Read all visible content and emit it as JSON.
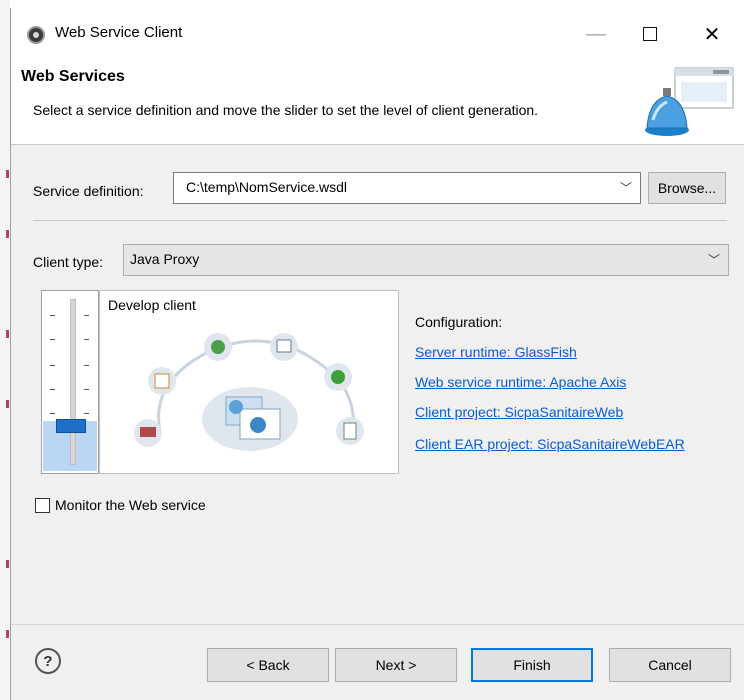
{
  "window": {
    "title": "Web Service Client",
    "minimize_glyph": "—",
    "close_glyph": "✕"
  },
  "header": {
    "title": "Web Services",
    "description": "Select a service definition and move the slider to set the level of client generation."
  },
  "service_definition": {
    "label": "Service definition:",
    "value": "C:\\temp\\NomService.wsdl",
    "browse_label": "Browse..."
  },
  "client_type": {
    "label": "Client type:",
    "value": "Java Proxy"
  },
  "slider": {
    "stage_label": "Develop client"
  },
  "configuration": {
    "heading": "Configuration:",
    "links": [
      "Server runtime: GlassFish",
      "Web service runtime: Apache Axis",
      "Client project: SicpaSanitaireWeb",
      "Client EAR project: SicpaSanitaireWebEAR"
    ]
  },
  "monitor": {
    "label": "Monitor the Web service",
    "checked": false
  },
  "buttons": {
    "help": "?",
    "back": "< Back",
    "next": "Next >",
    "finish": "Finish",
    "cancel": "Cancel"
  },
  "icons": {
    "combo_arrow": "﹀"
  },
  "colors": {
    "link": "#0a5ccf",
    "default_button_border": "#0078d7",
    "slider_thumb": "#1e6fc8"
  }
}
